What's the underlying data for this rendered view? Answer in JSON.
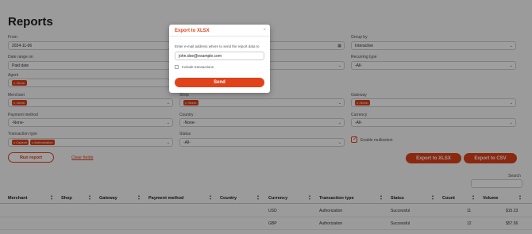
{
  "page": {
    "title": "Reports"
  },
  "filters": {
    "from_label": "From",
    "from_value": "2024-11-06",
    "group_by_label": "Group by",
    "group_by_value": "Interactive",
    "date_range_on_label": "Date range on",
    "date_range_on_value": "Paid date",
    "recurring_type_label": "Recurring type",
    "recurring_type_value": "-All-",
    "agent_label": "Agent",
    "agent_tag": "x -None-",
    "merchant_label": "Merchant",
    "merchant_tag": "x -None-",
    "shop_label": "Shop",
    "shop_tag": "x -None-",
    "gateway_label": "Gateway",
    "gateway_tag": "x -None-",
    "payment_method_label": "Payment method",
    "payment_method_value": "-None-",
    "country_label": "Country",
    "country_value": "-None-",
    "currency_label": "Currency",
    "currency_value": "-All-",
    "transaction_type_label": "Transaction type",
    "transaction_type_tags": [
      "x Capture",
      "x Authorization"
    ],
    "status_label": "Status",
    "status_value": "-All-",
    "enable_multiselect_label": "Enable multiselect"
  },
  "actions": {
    "run_report": "Run report",
    "clear_fields": "Clear fields",
    "export_xlsx": "Export to XLSX",
    "export_csv": "Export to CSV",
    "search_label": "Search"
  },
  "table": {
    "headers": [
      "Merchant",
      "Shop",
      "Gateway",
      "Payment method",
      "Country",
      "Currency",
      "Transaction type",
      "Status",
      "Count",
      "Volume"
    ],
    "rows": [
      [
        "",
        "",
        "",
        "",
        "",
        "USD",
        "Authorization",
        "Successful",
        "11",
        "$15.23"
      ],
      [
        "",
        "",
        "",
        "",
        "",
        "GBP",
        "Authorization",
        "Successful",
        "12",
        "$57.56"
      ]
    ]
  },
  "modal": {
    "title": "Export to XLSX",
    "close_glyph": "×",
    "instruction": "Enter e-mail address where to send the report data to",
    "email_value": "john.doe@example.com",
    "include_transactions_label": "Include transactions",
    "send_label": "Send"
  },
  "colors": {
    "accent": "#e0421a",
    "overlay": "rgba(0,0,0,0.38)"
  }
}
